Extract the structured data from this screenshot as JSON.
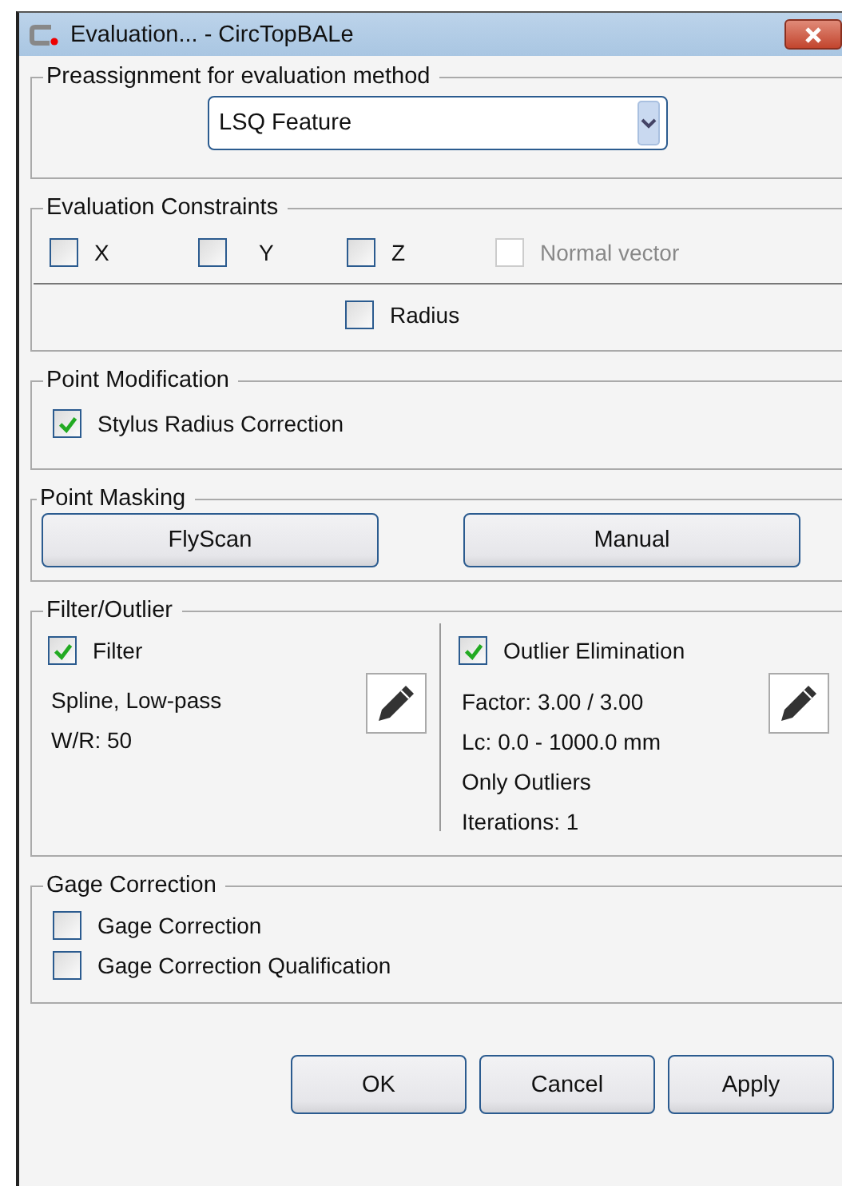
{
  "window": {
    "title": "Evaluation... - CircTopBALe"
  },
  "preassignment": {
    "title": "Preassignment for evaluation method",
    "value": "LSQ Feature"
  },
  "constraints": {
    "title": "Evaluation Constraints",
    "axes": [
      {
        "label": "X",
        "checked": false,
        "disabled": false
      },
      {
        "label": "Y",
        "checked": false,
        "disabled": false
      },
      {
        "label": "Z",
        "checked": false,
        "disabled": false
      },
      {
        "label": "Normal vector",
        "checked": false,
        "disabled": true
      }
    ],
    "radius": {
      "label": "Radius",
      "checked": false,
      "disabled": false
    }
  },
  "point_modification": {
    "title": "Point Modification",
    "options": [
      {
        "label": "Stylus Radius Correction",
        "checked": true
      }
    ]
  },
  "point_masking": {
    "title": "Point Masking",
    "buttons": [
      "FlyScan",
      "Manual"
    ]
  },
  "filter_outlier": {
    "title": "Filter/Outlier",
    "columns": [
      {
        "label": "Filter",
        "checked": true,
        "details": [
          "Spline, Low-pass",
          "W/R: 50"
        ]
      },
      {
        "label": "Outlier Elimination",
        "checked": true,
        "details": [
          "Factor: 3.00 / 3.00",
          "Lc: 0.0 - 1000.0 mm",
          "Only Outliers",
          "Iterations: 1"
        ]
      }
    ]
  },
  "gage_correction": {
    "title": "Gage Correction",
    "options": [
      {
        "label": "Gage Correction",
        "checked": false
      },
      {
        "label": "Gage Correction Qualification",
        "checked": false
      }
    ]
  },
  "buttons": [
    "OK",
    "Cancel",
    "Apply"
  ]
}
